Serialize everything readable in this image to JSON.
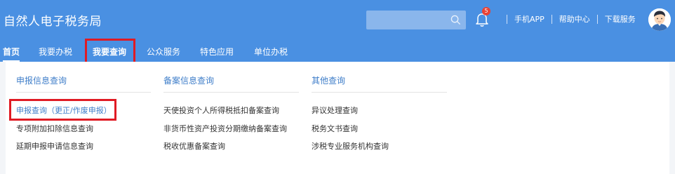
{
  "header": {
    "title": "自然人电子税务局",
    "search_placeholder": "",
    "notification_count": "5",
    "links": [
      "手机APP",
      "帮助中心",
      "下载服务"
    ]
  },
  "nav": {
    "items": [
      "首页",
      "我要办税",
      "我要查询",
      "公众服务",
      "特色应用",
      "单位办税"
    ],
    "active": "我要查询"
  },
  "menu": {
    "columns": [
      {
        "title": "申报信息查询",
        "items": [
          "申报查询（更正/作废申报）",
          "专项附加扣除信息查询",
          "延期申报申请信息查询"
        ]
      },
      {
        "title": "备案信息查询",
        "items": [
          "天使投资个人所得税抵扣备案查询",
          "非货币性资产投资分期缴纳备案查询",
          "税收优惠备案查询"
        ]
      },
      {
        "title": "其他查询",
        "items": [
          "异议处理查询",
          "税务文书查询",
          "涉税专业服务机构查询"
        ]
      }
    ]
  },
  "colors": {
    "header_bg": "#4a90e2",
    "accent": "#3f7ec9",
    "highlight": "#e01b24",
    "badge": "#e94235"
  },
  "icons": [
    "search-icon",
    "bell-icon",
    "avatar-icon"
  ]
}
